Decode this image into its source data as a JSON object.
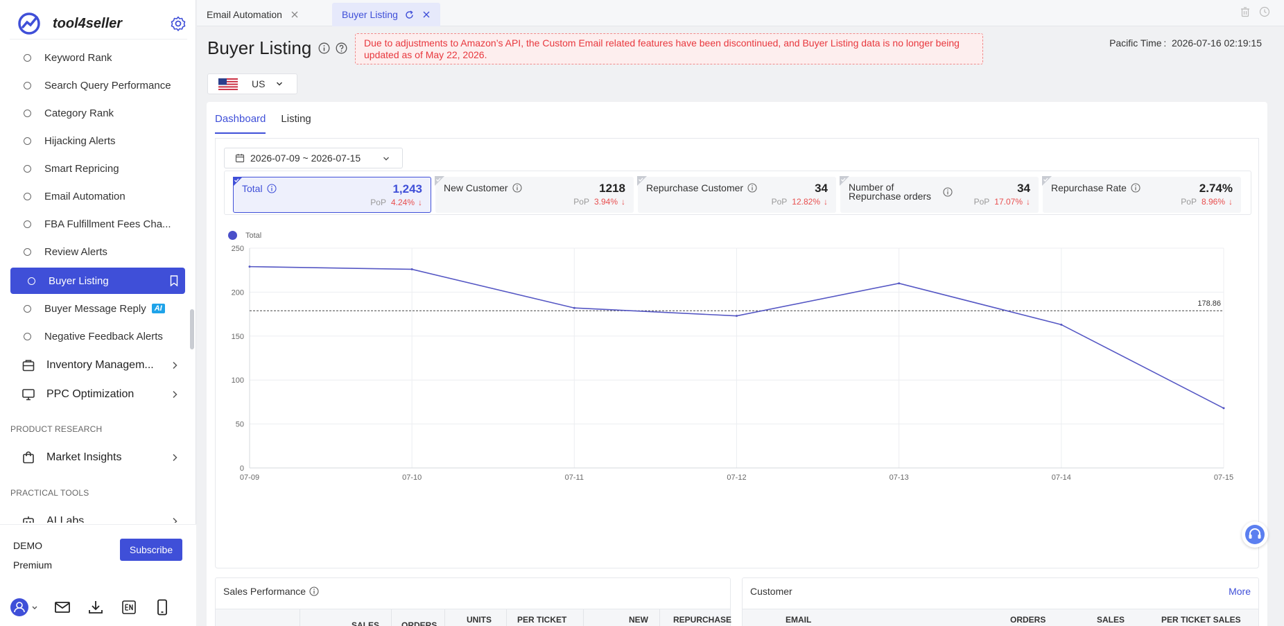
{
  "brand": {
    "name": "tool4seller"
  },
  "sidebar": {
    "items": [
      {
        "label": "Keyword Rank"
      },
      {
        "label": "Search Query Performance"
      },
      {
        "label": "Category Rank"
      },
      {
        "label": "Hijacking Alerts"
      },
      {
        "label": "Smart Repricing"
      },
      {
        "label": "Email Automation"
      },
      {
        "label": "FBA Fulfillment Fees Cha..."
      },
      {
        "label": "Review Alerts"
      },
      {
        "label": "Buyer Listing",
        "active": true
      },
      {
        "label": "Buyer Message Reply",
        "badge": "AI"
      },
      {
        "label": "Negative Feedback Alerts"
      }
    ],
    "groups": [
      {
        "label": "Inventory Managem..."
      },
      {
        "label": "PPC Optimization"
      }
    ],
    "section_product_research": "PRODUCT RESEARCH",
    "market_insights": "Market Insights",
    "section_practical_tools": "PRACTICAL TOOLS",
    "ai_labs": "AI Labs"
  },
  "account": {
    "name": "DEMO",
    "plan": "Premium",
    "subscribe_label": "Subscribe"
  },
  "tabs": [
    {
      "label": "Email Automation"
    },
    {
      "label": "Buyer Listing",
      "active": true
    }
  ],
  "header": {
    "title": "Buyer Listing",
    "notice": "Due to adjustments to Amazon’s API, the Custom Email related features have been discontinued, and Buyer Listing data is no longer being updated as of May 22, 2026.",
    "pacific_time_label": "Pacific Time :",
    "pacific_time_value": "2026-07-16 02:19:15"
  },
  "country": {
    "value": "US"
  },
  "subtabs": [
    {
      "label": "Dashboard",
      "active": true
    },
    {
      "label": "Listing"
    }
  ],
  "date_range": "2026-07-09 ~ 2026-07-15",
  "metrics": [
    {
      "label": "Total",
      "value": "1,243",
      "pop_label": "PoP",
      "pop_value": "4.24%",
      "selected": true
    },
    {
      "label": "New Customer",
      "value": "1218",
      "pop_label": "PoP",
      "pop_value": "3.94%"
    },
    {
      "label": "Repurchase Customer",
      "value": "34",
      "pop_label": "PoP",
      "pop_value": "12.82%"
    },
    {
      "label": "Number of Repurchase orders",
      "value": "34",
      "pop_label": "PoP",
      "pop_value": "17.07%"
    },
    {
      "label": "Repurchase Rate",
      "value": "2.74%",
      "pop_label": "PoP",
      "pop_value": "8.96%"
    }
  ],
  "chart_data": {
    "type": "line",
    "categories": [
      "07-09",
      "07-10",
      "07-11",
      "07-12",
      "07-13",
      "07-14",
      "07-15"
    ],
    "series": [
      {
        "name": "Total",
        "values": [
          229,
          226,
          182,
          173,
          210,
          163,
          68
        ],
        "color": "#5557c4"
      }
    ],
    "average_line": {
      "value": 178.86,
      "label": "178.86"
    },
    "ylim": [
      0,
      250
    ],
    "yticks": [
      0,
      50,
      100,
      150,
      200,
      250
    ],
    "legend": "top-left",
    "grid": true
  },
  "sales_panel": {
    "title": "Sales Performance",
    "columns": [
      "SALES",
      "ORDERS",
      "UNITS",
      "PER TICKET",
      "NEW",
      "REPURCHASE"
    ]
  },
  "customer_panel": {
    "title": "Customer",
    "more": "More",
    "columns": [
      "EMAIL",
      "ORDERS",
      "SALES",
      "PER TICKET SALES"
    ]
  },
  "colors": {
    "accent": "#3f4fd8",
    "down": "#e84e4e",
    "notice": "#e8373d"
  }
}
